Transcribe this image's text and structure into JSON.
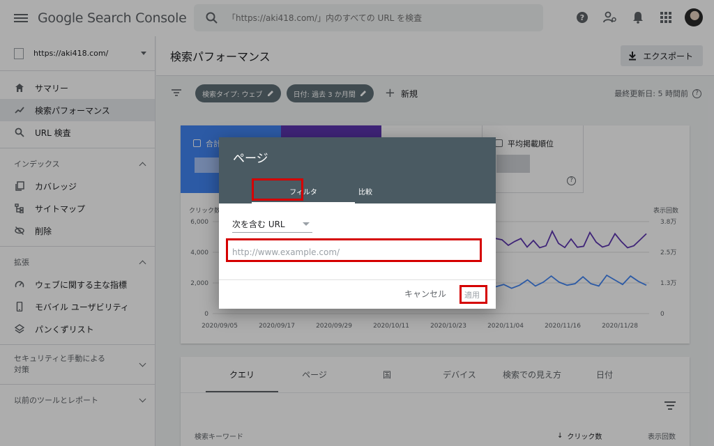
{
  "app": {
    "logo_text": "Google Search Console"
  },
  "search": {
    "placeholder": "「https://aki418.com/」内のすべての URL を検査"
  },
  "topbar": {
    "icons": [
      "help-icon",
      "manage-users-icon",
      "notifications-icon",
      "apps-icon",
      "avatar"
    ]
  },
  "sidebar": {
    "property": "https://aki418.com/",
    "items": [
      {
        "label": "サマリー",
        "icon": "home-icon"
      },
      {
        "label": "検索パフォーマンス",
        "icon": "trending-icon",
        "active": true
      },
      {
        "label": "URL 検査",
        "icon": "search-icon"
      }
    ],
    "index_section": "インデックス",
    "index_items": [
      {
        "label": "カバレッジ",
        "icon": "copy-icon"
      },
      {
        "label": "サイトマップ",
        "icon": "sitemap-icon"
      },
      {
        "label": "削除",
        "icon": "visibility-off-icon"
      }
    ],
    "enhance_section": "拡張",
    "enhance_items": [
      {
        "label": "ウェブに関する主な指標",
        "icon": "speed-icon"
      },
      {
        "label": "モバイル ユーザビリティ",
        "icon": "phone-icon"
      },
      {
        "label": "パンくずリスト",
        "icon": "layers-icon"
      }
    ],
    "security_section": "セキュリティと手動による対策",
    "legacy_section": "以前のツールとレポート"
  },
  "header": {
    "title": "検索パフォーマンス",
    "export_label": "エクスポート"
  },
  "filters": {
    "chips": [
      "検索タイプ: ウェブ",
      "日付: 過去 3 か月間"
    ],
    "new_label": "新規",
    "updated": "最終更新日: 5 時間前"
  },
  "metrics": {
    "m1_label": "合計",
    "m4_label": "平均掲載順位"
  },
  "chart_data": {
    "type": "line",
    "ylabel_left": "クリック数",
    "ylabel_right": "表示回数",
    "left_ticks": [
      "6,000",
      "4,000",
      "2,000",
      "0"
    ],
    "right_ticks": [
      "3.8万",
      "2.5万",
      "1.3万",
      "0"
    ],
    "x_ticks": [
      "2020/09/05",
      "2020/09/17",
      "2020/09/29",
      "2020/10/11",
      "2020/10/23",
      "2020/11/04",
      "2020/11/16",
      "2020/11/28"
    ],
    "series": [
      {
        "name": "clicks",
        "color": "#4285f4",
        "axis": "left",
        "visible_values": [
          1750,
          1900,
          1650,
          1850,
          2200,
          1800,
          2050,
          2450,
          2050,
          1850,
          1950,
          2400,
          1950,
          1800,
          2500,
          2200,
          1900,
          2450,
          2100,
          1850
        ]
      },
      {
        "name": "impressions",
        "color": "#5e35b1",
        "axis": "right",
        "visible_values": [
          31000,
          30500,
          28200,
          29800,
          31000,
          27500,
          30200,
          27200,
          28000,
          34000,
          29000,
          27300,
          30800,
          27400,
          27800,
          33500,
          29500,
          27500,
          28300,
          33000,
          29800,
          27200,
          28000,
          30500,
          33000
        ]
      }
    ]
  },
  "tabs": [
    "クエリ",
    "ページ",
    "国",
    "デバイス",
    "検索での見え方",
    "日付"
  ],
  "table": {
    "col1": "検索キーワード",
    "col2": "クリック数",
    "col3": "表示回数"
  },
  "dialog": {
    "title": "ページ",
    "tab_filter": "フィルタ",
    "tab_compare": "比較",
    "select_value": "次を含む URL",
    "input_placeholder": "http://www.example.com/",
    "cancel": "キャンセル",
    "apply": "適用",
    "highlight_color": "#d50000"
  }
}
